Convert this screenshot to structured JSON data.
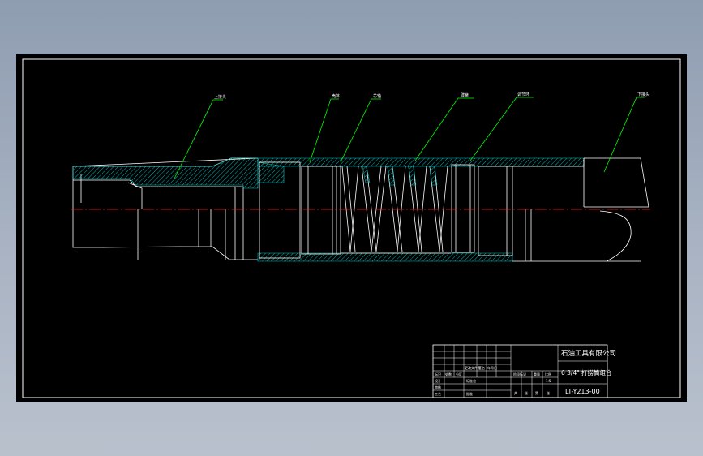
{
  "drawing": {
    "callouts": [
      "上接头",
      "壳体",
      "芯轴",
      "碟簧",
      "调节环",
      "下接头"
    ],
    "title_block": {
      "company": "石油工具有限公司",
      "part_name": "6 3/4\" 打捞筒组合",
      "drawing_number": "LT-Y213-00",
      "cells": [
        "标记",
        "处数",
        "分区",
        "更改文件号",
        "签名",
        "年月日",
        "设计",
        "标准化",
        "审核",
        "工艺",
        "批准",
        "阶段标记",
        "重量",
        "比例",
        "共",
        "张",
        "第",
        "张",
        "1:5"
      ]
    }
  },
  "colors": {
    "background": "#a3aec0",
    "sheet": "#000000",
    "line": "#ffffff",
    "hatch": "#00c8c8",
    "centerline": "#ff2020",
    "leader": "#00ff00"
  }
}
